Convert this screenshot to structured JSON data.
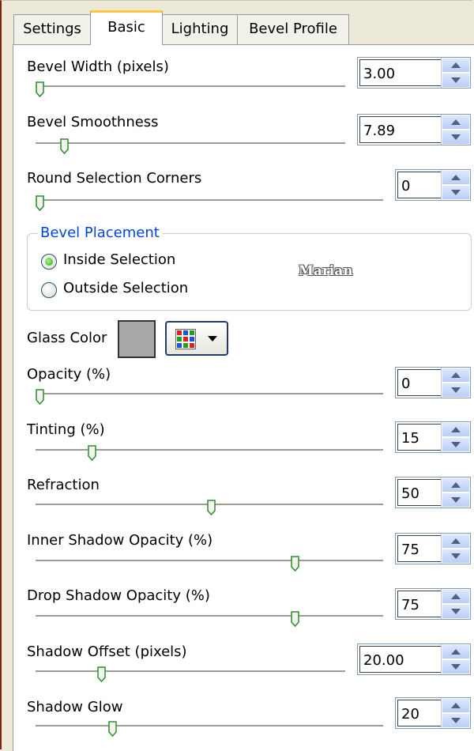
{
  "tabs": [
    {
      "label": "Settings",
      "active": false
    },
    {
      "label": "Basic",
      "active": true
    },
    {
      "label": "Lighting",
      "active": false
    },
    {
      "label": "Bevel Profile",
      "active": false
    }
  ],
  "controls": {
    "bevel_width": {
      "label": "Bevel Width (pixels)",
      "value": "3.00"
    },
    "bevel_smoothness": {
      "label": "Bevel Smoothness",
      "value": "7.89"
    },
    "round_corners": {
      "label": "Round Selection Corners",
      "value": "0"
    },
    "opacity": {
      "label": "Opacity (%)",
      "value": "0"
    },
    "tinting": {
      "label": "Tinting (%)",
      "value": "15"
    },
    "refraction": {
      "label": "Refraction",
      "value": "50"
    },
    "inner_shadow": {
      "label": "Inner Shadow Opacity (%)",
      "value": "75"
    },
    "drop_shadow": {
      "label": "Drop Shadow Opacity (%)",
      "value": "75"
    },
    "shadow_offset": {
      "label": "Shadow Offset (pixels)",
      "value": "20.00"
    },
    "shadow_glow": {
      "label": "Shadow Glow",
      "value": "20"
    }
  },
  "bevel_placement": {
    "title": "Bevel Placement",
    "options": [
      {
        "label": "Inside Selection",
        "selected": true
      },
      {
        "label": "Outside Selection",
        "selected": false
      }
    ]
  },
  "glass_color": {
    "label": "Glass Color",
    "swatch": "#a9a9a9"
  },
  "watermark": "Marian",
  "colors": {
    "tab_active_accent": "#ffc83c",
    "group_title": "#0046d5",
    "spin_button": "#c1d3fb"
  }
}
